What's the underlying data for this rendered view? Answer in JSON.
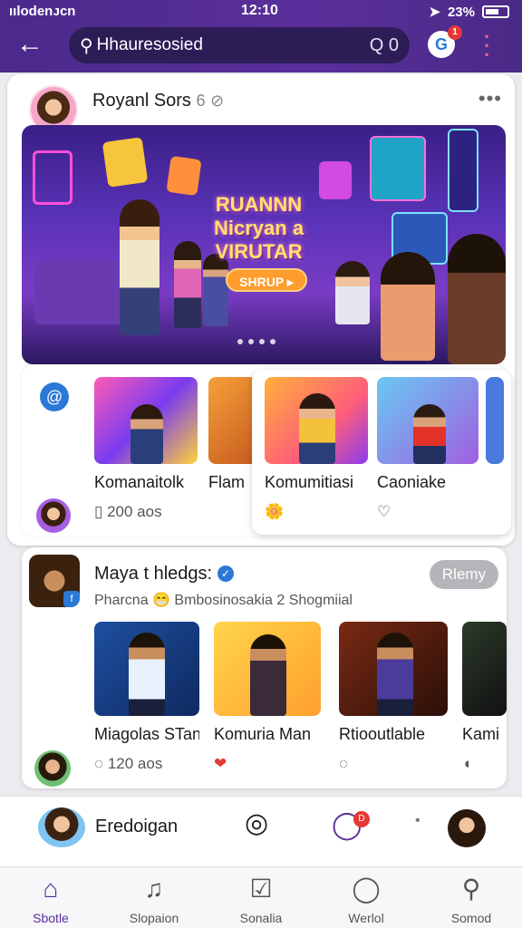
{
  "status_bar": {
    "carrier": "ıılodenᴊcn",
    "time": "12:10",
    "battery": "23%"
  },
  "header": {
    "search_text": "Hhauresosied",
    "search_right": "Q 0",
    "app_badge": "G",
    "badge_count": "1"
  },
  "post1": {
    "author": "Royanl Sors",
    "author_suffix": "6",
    "hero": {
      "title_line1": "RUANNN",
      "title_line2": "Nicryan a",
      "title_line3": "VIRUTAR",
      "cta": "SHRUP ▸"
    },
    "tiles": [
      {
        "label": "Komanaitolk",
        "meta": "200 aos"
      },
      {
        "label": "Flam",
        "meta": ""
      },
      {
        "label": "Komumitiasi",
        "meta": ""
      },
      {
        "label": "Caoniake",
        "meta": ""
      }
    ]
  },
  "post2": {
    "author": "Maya t hledgs:",
    "subtitle": "Pharcna 😁 Bmbosinosakia 2 Shogmiial",
    "follow": "Rlemy",
    "videos": [
      {
        "label": "Miagolas STan",
        "meta": "120 aos"
      },
      {
        "label": "Komuria Man",
        "meta": ""
      },
      {
        "label": "Rtiooutlable",
        "meta": ""
      },
      {
        "label": "Kami",
        "meta": ""
      }
    ]
  },
  "story_bar": {
    "label": "Eredoigan",
    "chat_badge": "D"
  },
  "tabs": [
    {
      "label": "Sbotle",
      "icon": "home-icon"
    },
    {
      "label": "Slopaion",
      "icon": "bell-icon"
    },
    {
      "label": "Sonalia",
      "icon": "check-icon"
    },
    {
      "label": "Werlol",
      "icon": "chat-icon"
    },
    {
      "label": "Somod",
      "icon": "search-icon"
    }
  ],
  "colors": {
    "accent": "#5a2f9b",
    "header_bg": "#4b2a8a",
    "badge_red": "#e53935",
    "verified_blue": "#2b79d6"
  }
}
